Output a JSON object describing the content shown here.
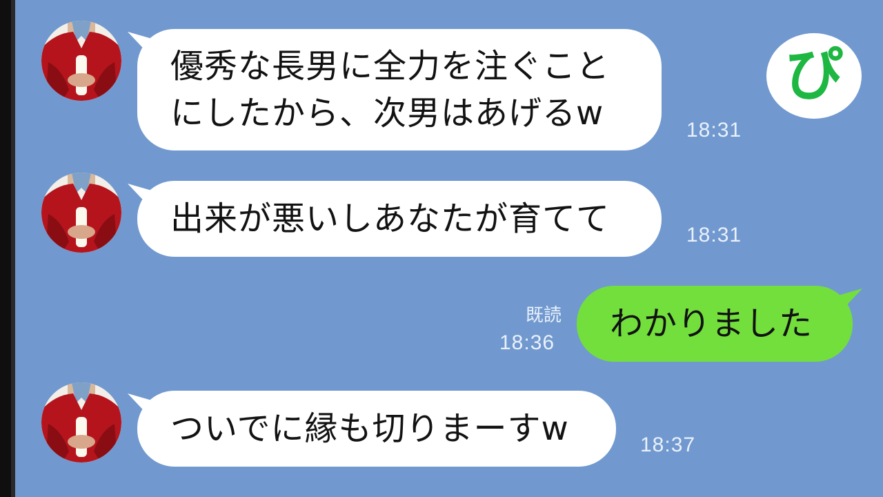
{
  "badge": {
    "label": "ぴ"
  },
  "messages": [
    {
      "text": "優秀な長男に全力を注ぐこと\nにしたから、次男はあげるw",
      "time": "18:31"
    },
    {
      "text": "出来が悪いしあなたが育てて",
      "time": "18:31"
    },
    {
      "text": "わかりました",
      "time": "18:36",
      "read": "既読"
    },
    {
      "text": "ついでに縁も切りまーすw",
      "time": "18:37"
    }
  ],
  "colors": {
    "background": "#7199cf",
    "received_bubble": "#ffffff",
    "sent_bubble": "#73df3c",
    "badge_text": "#1db742"
  },
  "icons": {
    "avatar": "contact-avatar-icon",
    "badge": "pi-logo-icon"
  }
}
